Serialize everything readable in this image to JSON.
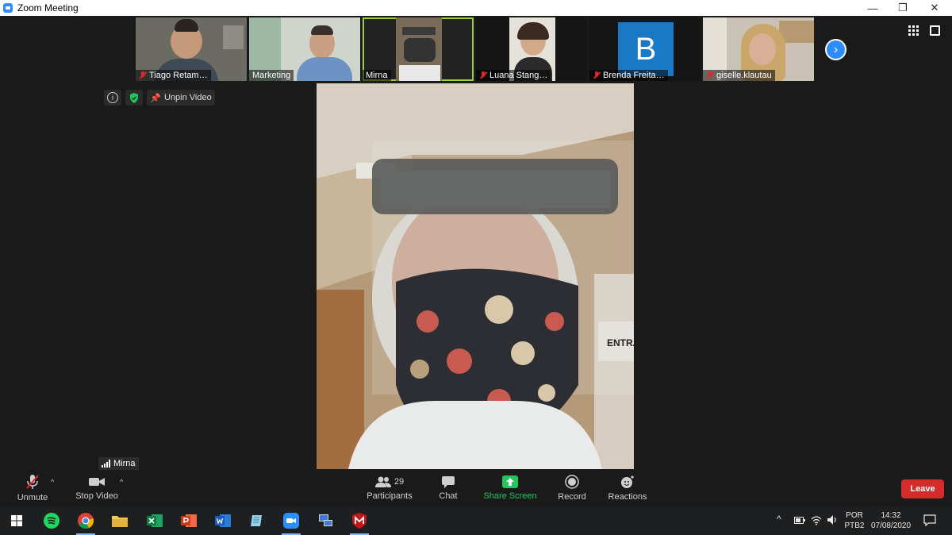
{
  "window": {
    "title": "Zoom Meeting",
    "controls": {
      "minimize": "—",
      "restore": "❐",
      "close": "✕"
    }
  },
  "gallery": {
    "thumbnails": [
      {
        "name": "Tiago Retam…",
        "muted": true,
        "bg": "#6b6a63"
      },
      {
        "name": "Marketing",
        "muted": false,
        "bg": "#cfd4cc"
      },
      {
        "name": "Mirna",
        "muted": false,
        "bg": "#222222",
        "active_speaker": true
      },
      {
        "name": "Luana Stang…",
        "muted": true,
        "bg": "#151515"
      },
      {
        "name": "Brenda Freita…",
        "muted": true,
        "bg": "#151515",
        "initial": "B",
        "initial_bg": "#1a79c7"
      },
      {
        "name": "giselle.klautau",
        "muted": true,
        "bg": "#c9c2b5"
      }
    ],
    "next_icon": "chevron-right-icon"
  },
  "view_controls": {
    "gallery_icon": "grid-icon",
    "fullscreen_icon": "fullscreen-icon"
  },
  "info_bar": {
    "info_icon": "i",
    "security_icon": "shield-icon",
    "unpin_label": "Unpin Video"
  },
  "main_video": {
    "speaker": "Mirna",
    "sign_text": "ENTRA"
  },
  "toolbar": {
    "unmute_label": "Unmute",
    "stop_video_label": "Stop Video",
    "participants_label": "Participants",
    "participants_count": "29",
    "chat_label": "Chat",
    "share_screen_label": "Share Screen",
    "record_label": "Record",
    "reactions_label": "Reactions",
    "leave_label": "Leave",
    "share_color": "#22c55e",
    "leave_color": "#d42b2b"
  },
  "taskbar": {
    "apps": [
      "windows-start",
      "spotify",
      "chrome",
      "file-explorer",
      "excel",
      "powerpoint",
      "word",
      "notepad",
      "zoom",
      "network-app",
      "mcafee"
    ],
    "tray": {
      "language": "POR",
      "keyboard": "PTB2",
      "time": "14:32",
      "date": "07/08/2020"
    }
  }
}
